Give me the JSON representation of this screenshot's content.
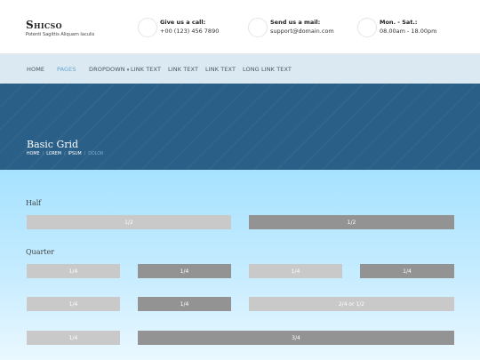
{
  "header": {
    "logo_name": "Shicso",
    "logo_tagline": "Potenti Sagittis Aliquam Iaculis",
    "contacts": [
      {
        "title": "Give us a call:",
        "value": "+00 (123) 456 7890",
        "icon": "phone-icon"
      },
      {
        "title": "Send us a mail:",
        "value": "support@domain.com",
        "icon": "mail-icon"
      },
      {
        "title": "Mon. - Sat.:",
        "value": "08.00am - 18.00pm",
        "icon": "clock-icon"
      }
    ]
  },
  "nav": {
    "items": [
      "HOME",
      "PAGES",
      "DROPDOWN",
      "LINK TEXT",
      "LINK TEXT",
      "LINK TEXT",
      "LONG LINK TEXT"
    ],
    "active_index": 1,
    "dropdown_arrow": "▾"
  },
  "hero": {
    "title": "Basic Grid",
    "breadcrumbs": [
      "HOME",
      "LOREM",
      "IPSUM",
      "DOLOR"
    ],
    "separator": "/"
  },
  "grid": {
    "half_label": "Half",
    "quarter_label": "Quarter",
    "half_row": [
      "1/2",
      "1/2"
    ],
    "quarter_row_1": [
      "1/4",
      "1/4",
      "1/4",
      "1/4"
    ],
    "quarter_row_2": [
      "1/4",
      "1/4",
      "2/4 or 1/2"
    ],
    "quarter_row_3": [
      "1/4",
      "3/4"
    ]
  },
  "colors": {
    "hero_bg": "#2a5f87",
    "nav_bg": "#dbe9f2",
    "nav_active": "#6aa3cf",
    "cell_light": "#c9c9c9",
    "cell_dark": "#939393"
  }
}
